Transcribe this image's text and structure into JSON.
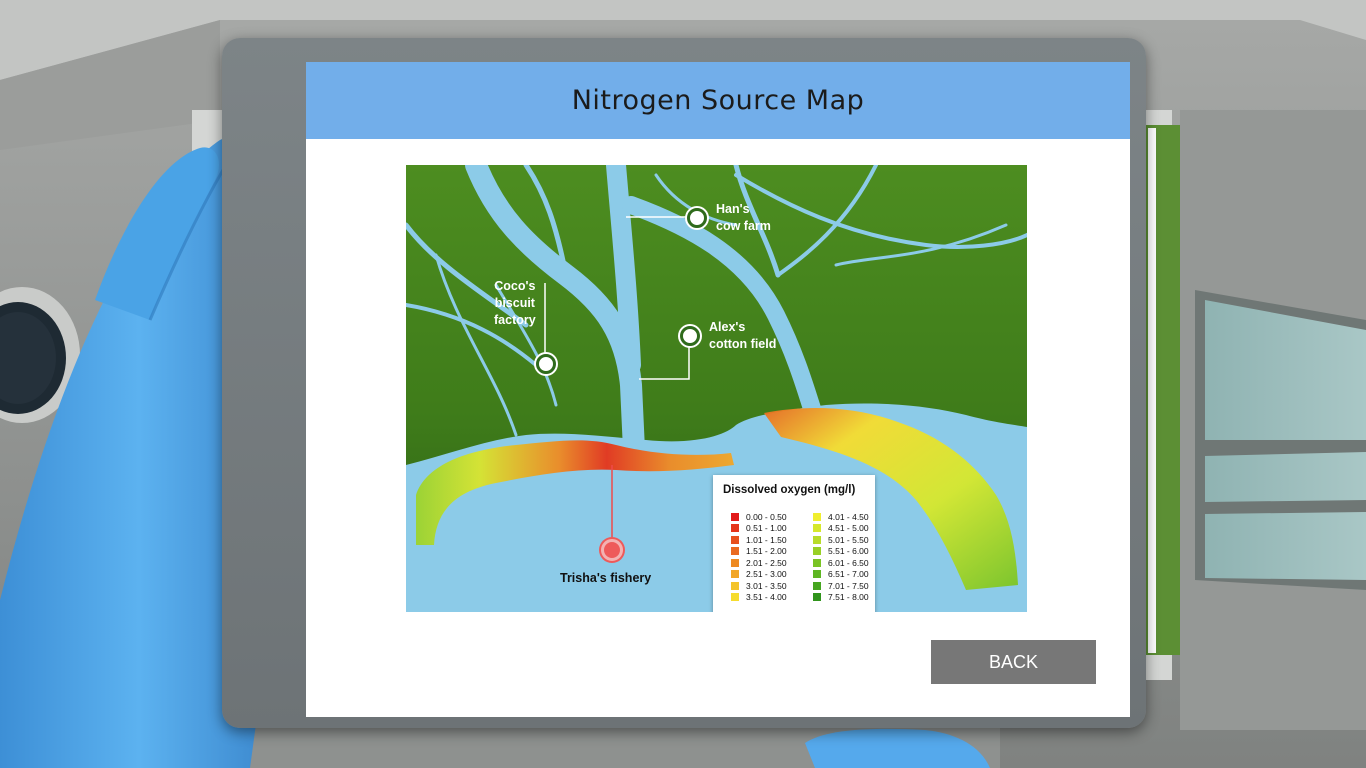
{
  "header": {
    "title": "Nitrogen Source Map"
  },
  "map": {
    "labels": {
      "hans": "Han's\ncow farm",
      "coco": "Coco's\nbiscuit\nfactory",
      "alex": "Alex's\ncotton field",
      "trisha": "Trisha's fishery"
    }
  },
  "legend": {
    "title": "Dissolved oxygen (mg/l)",
    "items": [
      {
        "range": "0.00 - 0.50",
        "color": "#e21a1a"
      },
      {
        "range": "0.51 - 1.00",
        "color": "#e5341a"
      },
      {
        "range": "1.01 - 1.50",
        "color": "#e8501d"
      },
      {
        "range": "1.51 - 2.00",
        "color": "#ea6a20"
      },
      {
        "range": "2.01 - 2.50",
        "color": "#ee8a22"
      },
      {
        "range": "2.51 - 3.00",
        "color": "#f2a626"
      },
      {
        "range": "3.01 - 3.50",
        "color": "#f4c42a"
      },
      {
        "range": "3.51 - 4.00",
        "color": "#f6dc2e"
      },
      {
        "range": "4.01 - 4.50",
        "color": "#f0ee2e"
      },
      {
        "range": "4.51 - 5.00",
        "color": "#d6e82c"
      },
      {
        "range": "5.01 - 5.50",
        "color": "#b8dc2a"
      },
      {
        "range": "5.51 - 6.00",
        "color": "#98d026"
      },
      {
        "range": "6.01 - 6.50",
        "color": "#7ac424"
      },
      {
        "range": "6.51 - 7.00",
        "color": "#5eb622"
      },
      {
        "range": "7.01 - 7.50",
        "color": "#46a620"
      },
      {
        "range": "7.51 - 8.00",
        "color": "#30941c"
      }
    ]
  },
  "buttons": {
    "back": "BACK"
  },
  "colors": {
    "header": "#72aeea",
    "land": "#3f7f1c",
    "water": "#8ccbe8",
    "button": "#777777"
  }
}
